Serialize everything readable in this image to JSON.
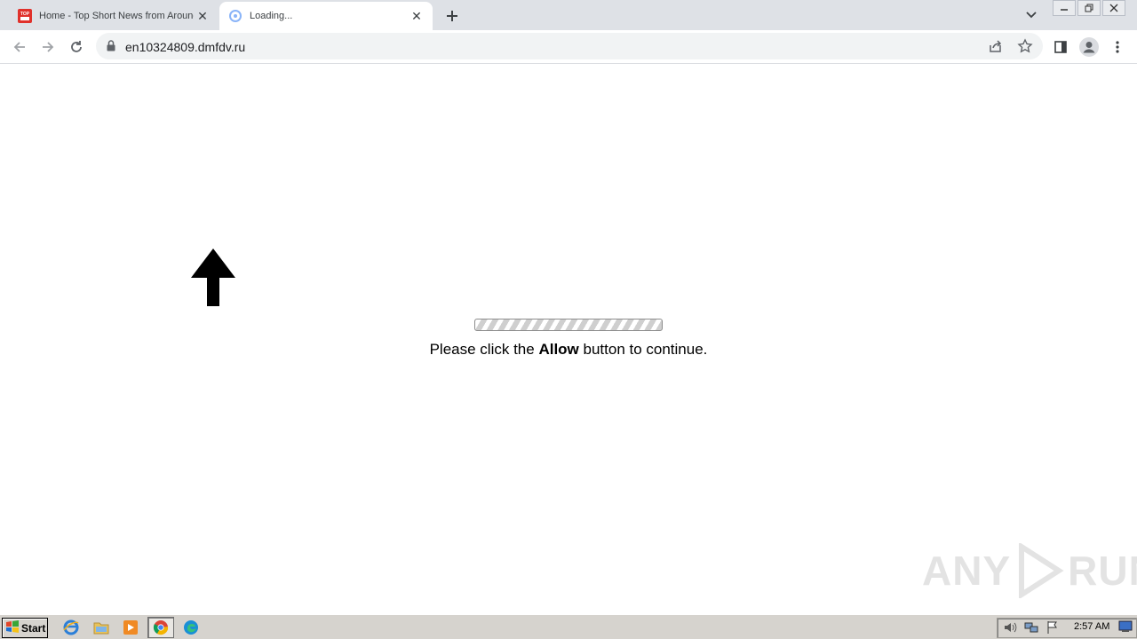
{
  "browser": {
    "tabs": [
      {
        "title": "Home - Top Short News from Around the World",
        "icon": "news-favicon-icon",
        "active": false
      },
      {
        "title": "Loading...",
        "icon": "loading-favicon-icon",
        "active": true
      }
    ],
    "address_bar": {
      "url": "en10324809.dmfdv.ru"
    }
  },
  "page": {
    "message_prefix": "Please click the ",
    "message_bold": "Allow",
    "message_suffix": " button to continue.",
    "watermark": "ANY RUN",
    "watermark_left": "ANY",
    "watermark_right": "RUN"
  },
  "taskbar": {
    "start_label": "Start",
    "apps": [
      "internet-explorer-icon",
      "file-explorer-icon",
      "media-player-icon",
      "chrome-icon",
      "edge-icon"
    ],
    "clock": "2:57 AM"
  },
  "colors": {
    "tabstrip": "#dee1e6",
    "omnibox": "#f1f3f4",
    "taskbar": "#d6d3ce"
  }
}
